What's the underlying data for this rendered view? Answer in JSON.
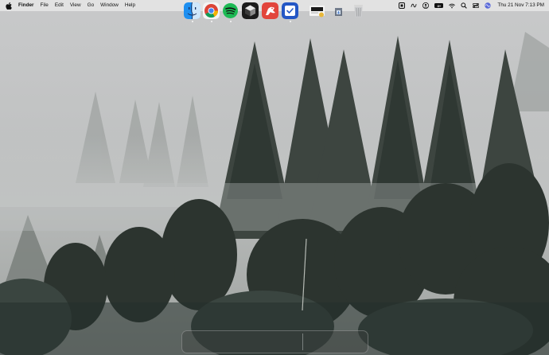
{
  "menubar": {
    "app_name": "Finder",
    "menus": [
      "File",
      "Edit",
      "View",
      "Go",
      "Window",
      "Help"
    ],
    "battery": "8+",
    "clock": "Thu 21 Nov  7:13 PM"
  },
  "status_icons": [
    "screen-record-icon",
    "script-icon",
    "user-icon",
    "battery-icon",
    "wifi-icon",
    "search-icon",
    "control-center-icon",
    "siri-icon"
  ],
  "dock": {
    "apps": [
      "finder",
      "chrome",
      "spotify",
      "cursor",
      "gitkraken",
      "tasks"
    ],
    "running": [
      "finder",
      "chrome",
      "spotify",
      "tasks"
    ],
    "recent": [
      "preview",
      "downloads",
      "trash"
    ]
  }
}
